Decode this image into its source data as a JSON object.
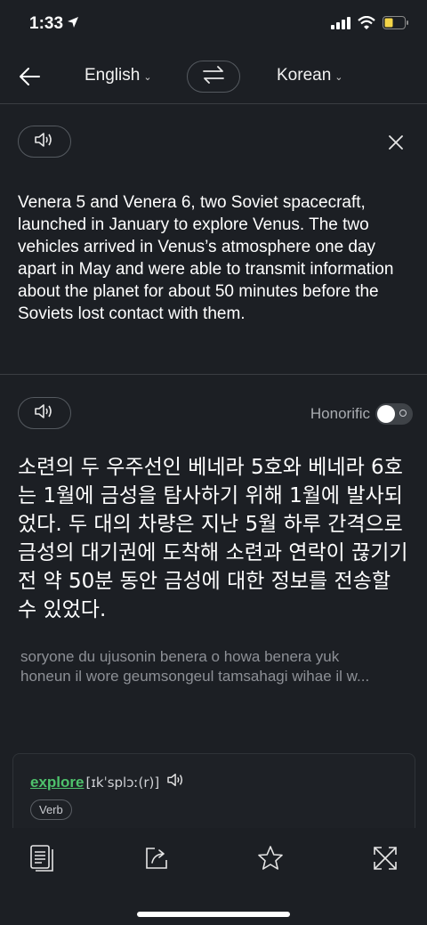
{
  "status": {
    "time": "1:33"
  },
  "topbar": {
    "source_lang": "English",
    "target_lang": "Korean"
  },
  "source": {
    "text": "Venera 5 and Venera 6, two Soviet spacecraft, launched in January to explore Venus. The two vehicles arrived in Venus’s atmosphere one day apart in May and were able to transmit information about the planet for about 50 minutes before the Soviets lost contact with them."
  },
  "target": {
    "honorific_label": "Honorific",
    "honorific_on": false,
    "text": "소련의 두 우주선인 베네라 5호와 베네라 6호는 1월에 금성을 탐사하기 위해 1월에 발사되었다. 두 대의 차량은 지난 5월 하루 간격으로 금성의 대기권에 도착해 소련과 연락이 끊기기 전 약 50분 동안 금성에 대한 정보를 전송할 수 있었다.",
    "romanization_line1": "soryone du ujusonin benera o howa benera yuk",
    "romanization_line2": "honeun il wore geumsongeul tamsahagi wihae il w..."
  },
  "dictionary": {
    "word": "explore",
    "ipa": "[ɪkˈsplɔː(r)]",
    "part_of_speech": "Verb"
  },
  "colors": {
    "accent_green": "#4ec26c",
    "background": "#1c1f24"
  },
  "icons": [
    "location-arrow-icon",
    "cellular-signal-icon",
    "wifi-icon",
    "battery-icon",
    "back-arrow-icon",
    "swap-icon",
    "speaker-icon",
    "close-icon",
    "document-icon",
    "share-icon",
    "star-icon",
    "expand-icon"
  ]
}
